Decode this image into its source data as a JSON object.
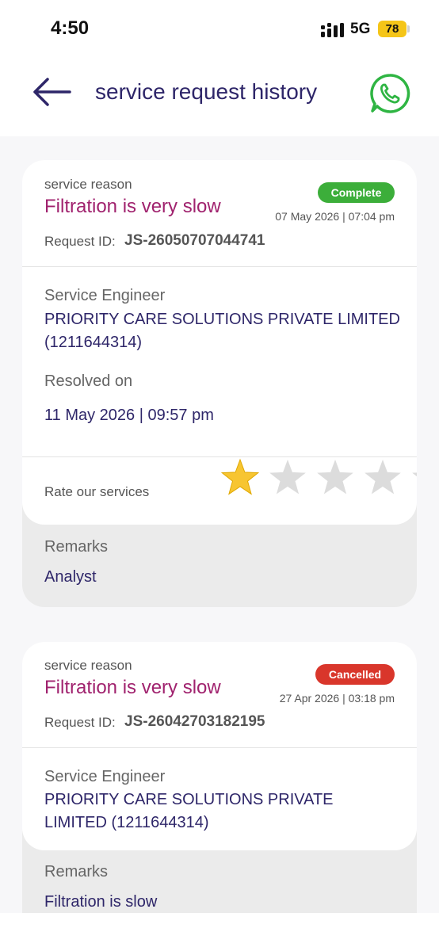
{
  "status_bar": {
    "time": "4:50",
    "network": "5G",
    "battery": "78"
  },
  "header": {
    "title": "service request history",
    "back_icon": "arrow-left-icon",
    "action_icon": "whatsapp-icon"
  },
  "requests": [
    {
      "reason_label": "service reason",
      "reason": "Filtration is very slow",
      "status": "Complete",
      "status_color": "#3cae3a",
      "date": "07 May 2026 | 07:04 pm",
      "request_id_label": "Request ID:",
      "request_id": "JS-26050707044741",
      "engineer_label": "Service Engineer",
      "engineer_line1": "PRIORITY CARE SOLUTIONS PRIVATE LIMITED",
      "engineer_line2": "(1211644314)",
      "resolved_label": "Resolved on",
      "resolved_on": "11 May 2026 | 09:57 pm",
      "rate_label": "Rate our services",
      "rating": 1,
      "rating_max": 5,
      "remarks_label": "Remarks",
      "remarks": "Analyst"
    },
    {
      "reason_label": "service reason",
      "reason": "Filtration is very slow",
      "status": "Cancelled",
      "status_color": "#d9362b",
      "date": "27 Apr 2026 | 03:18 pm",
      "request_id_label": "Request ID:",
      "request_id": "JS-26042703182195",
      "engineer_label": "Service Engineer",
      "engineer_line1": "PRIORITY CARE SOLUTIONS PRIVATE",
      "engineer_line2": "LIMITED (1211644314)",
      "remarks_label": "Remarks",
      "remarks": "Filtration is slow"
    }
  ],
  "colors": {
    "title": "#2e2669",
    "reason": "#a0226e",
    "star_filled": "#f7c531",
    "star_empty": "#dcdcdc"
  }
}
